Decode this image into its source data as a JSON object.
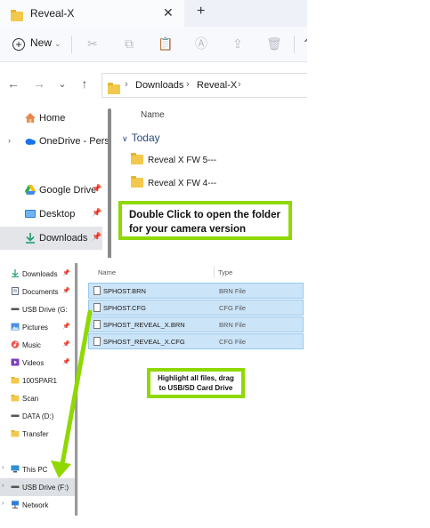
{
  "window_top": {
    "tab_title": "Reveal-X",
    "toolbar": {
      "new_label": "New"
    },
    "breadcrumb": [
      "Downloads",
      "Reveal-X"
    ],
    "nav": [
      {
        "label": "Home",
        "icon": "home-icon"
      },
      {
        "label": "OneDrive - Pers",
        "icon": "cloud-icon"
      },
      {
        "label": "Google Drive",
        "icon": "google-drive-icon"
      },
      {
        "label": "Desktop",
        "icon": "desktop-icon"
      },
      {
        "label": "Downloads",
        "icon": "download-icon"
      }
    ],
    "column_header": "Name",
    "group_label": "Today",
    "files": [
      {
        "name": "Reveal X FW 5---"
      },
      {
        "name": "Reveal X FW 4---"
      }
    ],
    "callout": "Double Click to open the folder for your camera version"
  },
  "window_bottom": {
    "nav": [
      {
        "label": "Downloads",
        "icon": "download-icon"
      },
      {
        "label": "Documents",
        "icon": "documents-icon"
      },
      {
        "label": "USB Drive (G:",
        "icon": "drive-icon"
      },
      {
        "label": "Pictures",
        "icon": "pictures-icon"
      },
      {
        "label": "Music",
        "icon": "music-icon"
      },
      {
        "label": "Videos",
        "icon": "videos-icon"
      },
      {
        "label": "100SPAR1",
        "icon": "folder-icon"
      },
      {
        "label": "Scan",
        "icon": "folder-icon"
      },
      {
        "label": "DATA (D:)",
        "icon": "drive-icon"
      },
      {
        "label": "Transfer",
        "icon": "folder-icon"
      },
      {
        "label": "This PC",
        "icon": "pc-icon"
      },
      {
        "label": "USB Drive (F:)",
        "icon": "drive-icon"
      },
      {
        "label": "Network",
        "icon": "network-icon"
      }
    ],
    "columns": {
      "name": "Name",
      "type": "Type"
    },
    "files": [
      {
        "name": "SPHOST.BRN",
        "type": "BRN File"
      },
      {
        "name": "SPHOST.CFG",
        "type": "CFG File"
      },
      {
        "name": "SPHOST_REVEAL_X.BRN",
        "type": "BRN File"
      },
      {
        "name": "SPHOST_REVEAL_X.CFG",
        "type": "CFG File"
      }
    ],
    "callout": "Highlight all files, drag to USB/SD Card Drive"
  },
  "colors": {
    "accent_green": "#8fd800",
    "selection": "#cce4f7",
    "folder": "#f2c94c"
  }
}
